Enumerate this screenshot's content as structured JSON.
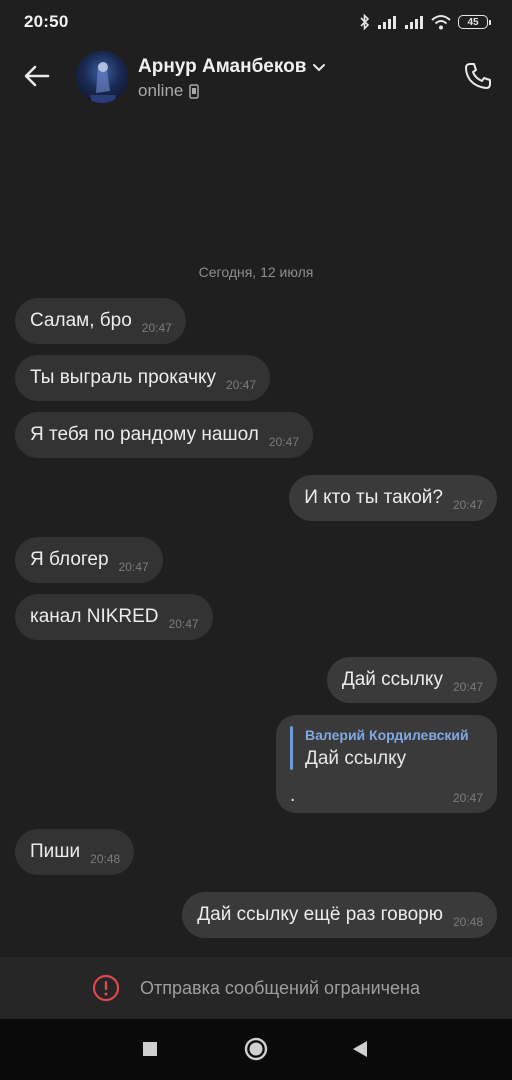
{
  "status_bar": {
    "time": "20:50",
    "battery": "45"
  },
  "header": {
    "contact_name": "Арнур Аманбеков",
    "status": "online"
  },
  "chat": {
    "date_separator": "Сегодня, 12 июля",
    "messages": [
      {
        "direction": "in",
        "text": "Салам, бро",
        "time": "20:47"
      },
      {
        "direction": "in",
        "text": "Ты выграль прокачку",
        "time": "20:47"
      },
      {
        "direction": "in",
        "text": "Я тебя по рандому нашол",
        "time": "20:47"
      },
      {
        "direction": "out",
        "text": "И кто ты такой?",
        "time": "20:47"
      },
      {
        "direction": "in",
        "text": "Я блогер",
        "time": "20:47"
      },
      {
        "direction": "in",
        "text": "канал NIKRED",
        "time": "20:47"
      },
      {
        "direction": "out",
        "text": "Дай ссылку",
        "time": "20:47"
      },
      {
        "direction": "out",
        "text": ".",
        "time": "20:47",
        "reply_author": "Валерий Кордилевский",
        "reply_text": "Дай ссылку"
      },
      {
        "direction": "in",
        "text": "Пиши",
        "time": "20:48"
      },
      {
        "direction": "out",
        "text": "Дай ссылку ещё раз говорю",
        "time": "20:48"
      }
    ]
  },
  "footer": {
    "restricted_text": "Отправка сообщений ограничена"
  },
  "colors": {
    "background": "#1f1f1f",
    "bubble": "#333333",
    "reply_accent": "#6d9bd6",
    "warning": "#e0484d"
  }
}
